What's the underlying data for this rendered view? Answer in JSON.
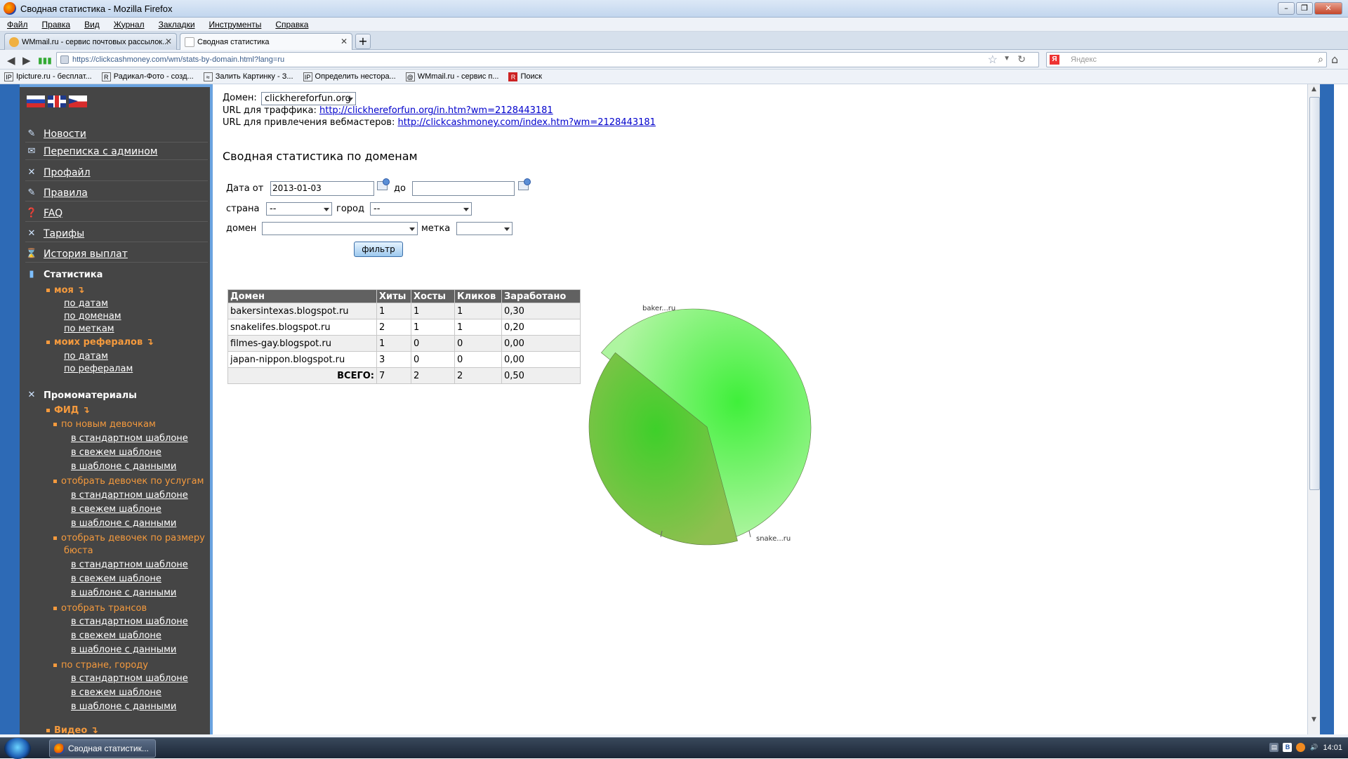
{
  "window": {
    "title": "Сводная статистика - Mozilla Firefox"
  },
  "menu": [
    "Файл",
    "Правка",
    "Вид",
    "Журнал",
    "Закладки",
    "Инструменты",
    "Справка"
  ],
  "tabs": [
    {
      "label": "WMmail.ru - сервис почтовых рассылок..."
    },
    {
      "label": "Сводная статистика"
    }
  ],
  "nav": {
    "url": "https://clickcashmoney.com/wm/stats-by-domain.html?lang=ru",
    "search_placeholder": "Яндекс"
  },
  "bookmarks": [
    {
      "label": "Ipicture.ru - бесплат...",
      "icon": "IP"
    },
    {
      "label": "Радикал-Фото - созд...",
      "icon": "R"
    },
    {
      "label": "Залить Картинку - З...",
      "icon": "≈"
    },
    {
      "label": "Определить нестора...",
      "icon": "IP"
    },
    {
      "label": "WMmail.ru - сервис п...",
      "icon": "@"
    },
    {
      "label": "Поиск",
      "icon": "R"
    }
  ],
  "sidebar": {
    "items": [
      {
        "label": "Новости",
        "icon": "✎"
      },
      {
        "label": "Переписка с админом",
        "icon": "✉"
      },
      {
        "label": "Профайл",
        "icon": "✕"
      },
      {
        "label": "Правила",
        "icon": "✎"
      },
      {
        "label": "FAQ",
        "icon": "❓"
      },
      {
        "label": "Тарифы",
        "icon": "✕"
      },
      {
        "label": "История выплат",
        "icon": "⌛"
      }
    ],
    "stats": {
      "title": "Статистика",
      "my": "моя",
      "my_links": [
        "по датам",
        "по доменам",
        "по меткам"
      ],
      "ref": "моих рефералов",
      "ref_links": [
        "по датам",
        "по рефералам"
      ]
    },
    "promo": {
      "title": "Промоматериалы",
      "feed": "ФИД",
      "groups": [
        {
          "title": "по новым девочкам",
          "links": [
            "в стандартном шаблоне",
            "в свежем шаблоне",
            "в шаблоне с данными"
          ]
        },
        {
          "title": "отобрать девочек по услугам",
          "links": [
            "в стандартном шаблоне",
            "в свежем шаблоне",
            "в шаблоне с данными"
          ]
        },
        {
          "title": "отобрать девочек по размеру",
          "title2": "бюста",
          "links": [
            "в стандартном шаблоне",
            "в свежем шаблоне",
            "в шаблоне с данными"
          ]
        },
        {
          "title": "отобрать трансов",
          "links": [
            "в стандартном шаблоне",
            "в свежем шаблоне",
            "в шаблоне с данными"
          ]
        },
        {
          "title": "по стране, городу",
          "links": [
            "в стандартном шаблоне",
            "в свежем шаблоне",
            "в шаблоне с данными"
          ]
        }
      ],
      "video": "Видео"
    }
  },
  "main": {
    "domain_label": "Домен:",
    "domain_value": "clickhereforfun.org",
    "traffic_label": "URL для траффика:",
    "traffic_url": "http://clickhereforfun.org/in.htm?wm=2128443181",
    "webmaster_label": "URL для привлечения вебмастеров:",
    "webmaster_url": "http://clickcashmoney.com/index.htm?wm=2128443181",
    "title": "Сводная статистика по доменам",
    "filter": {
      "date_from_label": "Дата от",
      "date_from": "2013-01-03",
      "date_to_label": "до",
      "date_to": "",
      "country_label": "страна",
      "country_value": "--",
      "city_label": "город",
      "city_value": "--",
      "domain_label": "домен",
      "domain_value": "",
      "tag_label": "метка",
      "tag_value": "",
      "button": "фильтр"
    },
    "table": {
      "headers": [
        "Домен",
        "Хиты",
        "Хосты",
        "Кликов",
        "Заработано"
      ],
      "rows": [
        [
          "bakersintexas.blogspot.ru",
          "1",
          "1",
          "1",
          "0,30"
        ],
        [
          "snakelifes.blogspot.ru",
          "2",
          "1",
          "1",
          "0,20"
        ],
        [
          "filmes-gay.blogspot.ru",
          "1",
          "0",
          "0",
          "0,00"
        ],
        [
          "japan-nippon.blogspot.ru",
          "3",
          "0",
          "0",
          "0,00"
        ]
      ],
      "total_label": "ВСЕГО:",
      "totals": [
        "7",
        "2",
        "2",
        "0,50"
      ]
    }
  },
  "chart_data": {
    "type": "pie",
    "labels": [
      "baker...ru",
      "snake...ru"
    ],
    "values": [
      0.3,
      0.2
    ],
    "colors": [
      "#7ef57a",
      "#72c43e"
    ]
  },
  "taskbar": {
    "item": "Сводная статистик...",
    "clock": "14:01"
  }
}
